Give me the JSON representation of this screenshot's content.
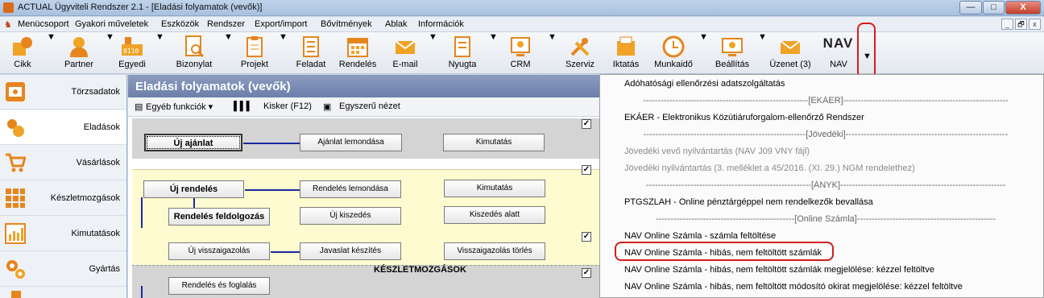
{
  "window": {
    "title": "ACTUAL Ügyviteli Rendszer 2.1 - [Eladási folyamatok (vevők)]",
    "minimize": "—",
    "maximize": "□",
    "close": "X"
  },
  "menu": {
    "items": [
      "Menücsoport",
      "Gyakori műveletek",
      "Eszközök",
      "Rendszer",
      "Export/import",
      "Bővítmények",
      "Ablak",
      "Információk"
    ],
    "mdi": [
      "_",
      "🗗",
      "x"
    ]
  },
  "toolbar": {
    "items": [
      "Cikk",
      "Partner",
      "Egyedi",
      "Bizonylat",
      "Projekt",
      "Feladat",
      "Rendelés",
      "E-mail",
      "Nyugta",
      "CRM",
      "Szerviz",
      "Iktatás",
      "Munkaidő",
      "Beállítás",
      "Üzenet (3)",
      "NAV"
    ],
    "nav_logo": "NAV"
  },
  "sidebar": {
    "items": [
      "Törzsadatok",
      "Eladások",
      "Vásárlások",
      "Készletmozgások",
      "Kimutatások",
      "Gyártás"
    ]
  },
  "panel": {
    "title": "Eladási folyamatok (vevők)",
    "bar": {
      "func": "Egyéb funkciók ▾",
      "kisker": "Kisker (F12)",
      "simple": "Egyszerű nézet"
    },
    "s1": {
      "new_offer": "Új ajánlat",
      "cancel_offer": "Ajánlat lemondása",
      "report": "Kimutatás"
    },
    "s2": {
      "new_order": "Új rendelés",
      "cancel_order": "Rendelés lemondása",
      "report": "Kimutatás",
      "process": "Rendelés feldolgozás",
      "new_pick": "Új kiszedés",
      "picking": "Kiszedés alatt"
    },
    "s3": {
      "new_confirm": "Új visszaigazolás",
      "proposal": "Javaslat készítés",
      "delete_confirm": "Visszaigazolás törlés"
    },
    "s4": {
      "header": "KÉSZLETMOZGÁSOK",
      "reserve": "Rendelés és foglalás"
    }
  },
  "dropdown": {
    "items": [
      {
        "text": "Adóhatósági ellenőrzési adatszolgáltatás",
        "type": "item"
      },
      {
        "text": "--------------------------------------------------------[EKÁER]--------------------------------------------------------",
        "type": "sep"
      },
      {
        "text": "EKÁER - Elektronikus Közútiáruforgalom-ellenőrző Rendszer",
        "type": "item"
      },
      {
        "text": "-------------------------------------------------------[Jövedéki]-------------------------------------------------------",
        "type": "sep"
      },
      {
        "text": "Jövedéki vevő nyilvántartás (NAV J09 VNY fájl)",
        "type": "dis"
      },
      {
        "text": "Jövedéki nyilvántartás (3. melléklet a 45/2016. (XI. 29.) NGM rendelethez)",
        "type": "dis"
      },
      {
        "text": "--------------------------------------------------------[ÁNYK]--------------------------------------------------------",
        "type": "sep"
      },
      {
        "text": "PTGSZLAH - Online pénztárgéppel nem rendelkezők bevallása",
        "type": "item"
      },
      {
        "text": "-----------------------------------------------[Online Számla]-----------------------------------------------",
        "type": "sep"
      },
      {
        "text": "NAV Online Számla - számla feltöltése",
        "type": "item"
      },
      {
        "text": "NAV Online Számla - hibás, nem feltöltött számlák",
        "type": "item"
      },
      {
        "text": "NAV Online Számla - hibás, nem feltöltött számlák megjelölése: kézzel feltöltve",
        "type": "item"
      },
      {
        "text": "NAV Online Számla - hibás, nem feltöltött módosító okirat megjelölése: kézzel feltöltve",
        "type": "item"
      }
    ]
  }
}
